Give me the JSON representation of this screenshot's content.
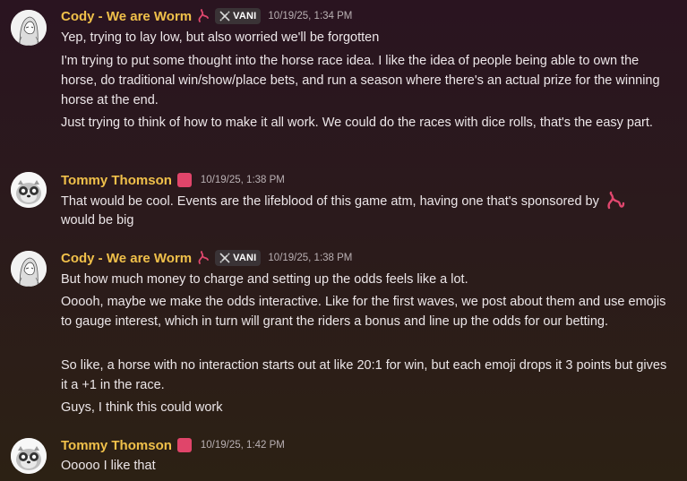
{
  "messages": [
    {
      "author": "Cody - We are Worm",
      "tag": "VANI",
      "timestamp": "10/19/25, 1:34 PM",
      "lines": [
        "Yep, trying to lay low, but also worried we'll be forgotten",
        "I'm trying to put some thought into the horse race idea. I like the idea of people being able to own the horse, do traditional win/show/place bets, and run a season where there's an actual prize for the winning horse at the end.",
        "Just trying to think of how to make it all work. We could do the races with dice rolls, that's the easy part."
      ]
    },
    {
      "author": "Tommy Thomson",
      "timestamp": "10/19/25, 1:38 PM",
      "lines": [
        "That would be cool. Events are the lifeblood of this game atm, having one that's sponsored by",
        "would be big"
      ]
    },
    {
      "author": "Cody - We are Worm",
      "tag": "VANI",
      "timestamp": "10/19/25, 1:38 PM",
      "lines": [
        "But how much money to charge and setting up the odds feels like a lot.",
        "Ooooh, maybe we make the odds interactive. Like for the first waves, we post about them and use emojis to gauge interest, which in turn will grant the riders a bonus and line up the odds for our betting.",
        "So like, a horse with no interaction starts out at like 20:1 for win, but each emoji drops it 3 points but gives it a +1 in the race.",
        "Guys, I think this could work"
      ]
    },
    {
      "author": "Tommy Thomson",
      "timestamp": "10/19/25, 1:42 PM",
      "lines": [
        "Ooooo I like that"
      ]
    }
  ],
  "icons": {
    "worm": "worm-icon",
    "swords": "crossed-swords-icon",
    "role_square": "pink-square",
    "colors": {
      "username": "#f0c04a",
      "worm": "#e0476e",
      "square": "#e0456a"
    }
  }
}
